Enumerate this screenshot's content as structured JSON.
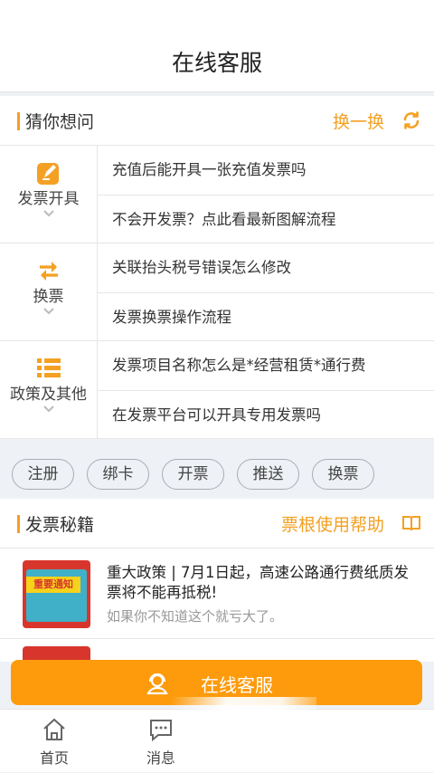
{
  "header": {
    "title": "在线客服"
  },
  "guess": {
    "title": "猜你想问",
    "refresh_label": "换一换",
    "categories": [
      {
        "label": "发票开具",
        "icon": "edit-icon",
        "questions": [
          "充值后能开具一张充值发票吗",
          "不会开发票？点此看最新图解流程"
        ]
      },
      {
        "label": "换票",
        "icon": "swap-icon",
        "questions": [
          "关联抬头税号错误怎么修改",
          "发票换票操作流程"
        ]
      },
      {
        "label": "政策及其他",
        "icon": "list-icon",
        "questions": [
          "发票项目名称怎么是*经营租赁*通行费",
          "在发票平台可以开具专用发票吗"
        ]
      }
    ]
  },
  "tags": [
    "注册",
    "绑卡",
    "开票",
    "推送",
    "换票"
  ],
  "secrets": {
    "title": "发票秘籍",
    "help_label": "票根使用帮助",
    "articles": [
      {
        "title": "重大政策 | 7月1日起，高速公路通行费纸质发票将不能再抵税!",
        "subtitle": "如果你不知道这个就亏大了。",
        "thumb_text": "重要通知"
      }
    ]
  },
  "cta": {
    "label": "在线客服"
  },
  "tabbar": [
    {
      "label": "首页",
      "icon": "home-icon"
    },
    {
      "label": "消息",
      "icon": "message-icon"
    }
  ],
  "colors": {
    "accent": "#f3a023",
    "cta": "#fd9b0c",
    "divider": "#e6e6e6"
  }
}
